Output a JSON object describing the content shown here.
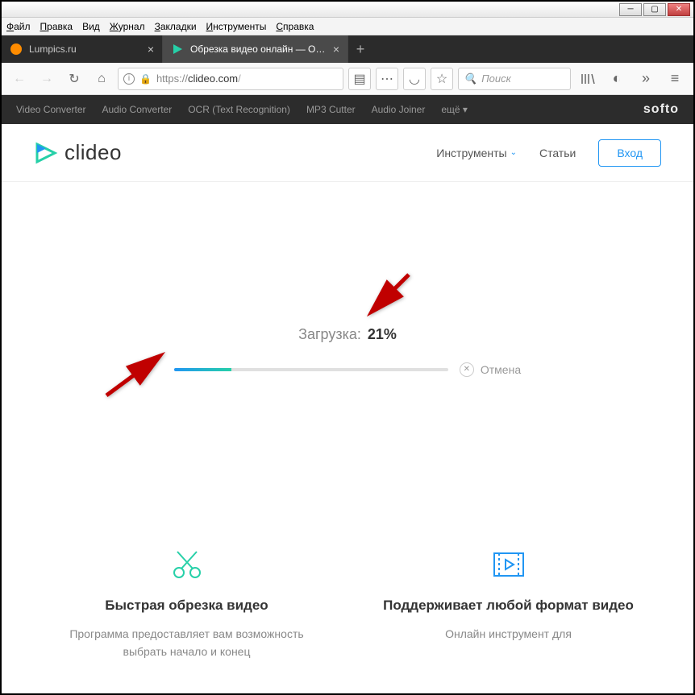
{
  "menubar": [
    "Файл",
    "Правка",
    "Вид",
    "Журнал",
    "Закладки",
    "Инструменты",
    "Справка"
  ],
  "tabs": [
    {
      "label": "Lumpics.ru",
      "active": false,
      "icon": "orange"
    },
    {
      "label": "Обрезка видео онлайн — Обр",
      "active": true,
      "icon": "clideo"
    }
  ],
  "url": {
    "proto": "https://",
    "domain": "clideo.com",
    "path": "/"
  },
  "search_placeholder": "Поиск",
  "softo": {
    "items": [
      "Video Converter",
      "Audio Converter",
      "OCR (Text Recognition)",
      "MP3 Cutter",
      "Audio Joiner",
      "ещё ▾"
    ],
    "brand": "softo"
  },
  "logo_text": "clideo",
  "nav": {
    "tools": "Инструменты",
    "articles": "Статьи",
    "login": "Вход"
  },
  "upload": {
    "label": "Загрузка:",
    "percent_text": "21%",
    "percent": 21,
    "cancel": "Отмена"
  },
  "features": [
    {
      "title": "Быстрая обрезка видео",
      "desc": "Программа предоставляет вам возможность выбрать начало и конец"
    },
    {
      "title": "Поддерживает любой формат видео",
      "desc": "Онлайн инструмент для"
    }
  ]
}
